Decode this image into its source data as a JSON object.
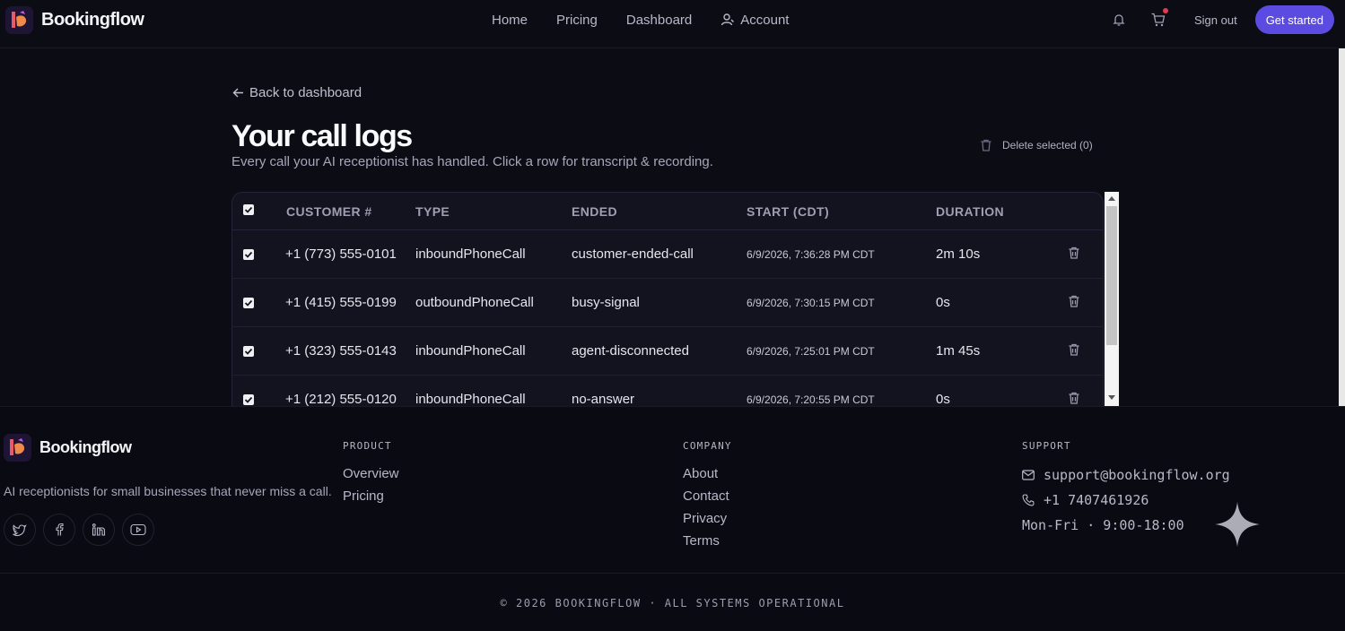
{
  "brand": {
    "name": "Bookingflow"
  },
  "nav": {
    "links": [
      "Home",
      "Pricing",
      "Dashboard",
      "Account"
    ],
    "sign_out": "Sign out",
    "get_started": "Get started",
    "cart_has_items": true
  },
  "page": {
    "back_label": "Back to dashboard",
    "title": "Your call logs",
    "subtitle": "Every call your AI receptionist has handled. Click a row for transcript & recording.",
    "delete_selected": "Delete selected (0)"
  },
  "table": {
    "columns": [
      "CUSTOMER #",
      "TYPE",
      "ENDED",
      "START (CDT)",
      "DURATION"
    ],
    "rows": [
      {
        "customer": "+1 (773) 555-0101",
        "type": "inboundPhoneCall",
        "ended": "customer-ended-call",
        "start": "6/9/2026, 7:36:28 PM CDT",
        "duration": "2m 10s"
      },
      {
        "customer": "+1 (415) 555-0199",
        "type": "outboundPhoneCall",
        "ended": "busy-signal",
        "start": "6/9/2026, 7:30:15 PM CDT",
        "duration": "0s"
      },
      {
        "customer": "+1 (323) 555-0143",
        "type": "inboundPhoneCall",
        "ended": "agent-disconnected",
        "start": "6/9/2026, 7:25:01 PM CDT",
        "duration": "1m 45s"
      },
      {
        "customer": "+1 (212) 555-0120",
        "type": "inboundPhoneCall",
        "ended": "no-answer",
        "start": "6/9/2026, 7:20:55 PM CDT",
        "duration": "0s"
      }
    ]
  },
  "footer": {
    "tagline": "AI receptionists for small businesses that never miss a call.",
    "socials": [
      "twitter-icon",
      "facebook-icon",
      "linkedin-icon",
      "youtube-icon"
    ],
    "product": {
      "title": "PRODUCT",
      "links": [
        "Overview",
        "Pricing"
      ]
    },
    "company": {
      "title": "COMPANY",
      "links": [
        "About",
        "Contact",
        "Privacy",
        "Terms"
      ]
    },
    "support": {
      "title": "SUPPORT",
      "email": "support@bookingflow.org",
      "phone": "+1 7407461926",
      "hours": "Mon-Fri · 9:00-18:00"
    },
    "copyright": "© 2026 BOOKINGFLOW · ALL SYSTEMS OPERATIONAL"
  },
  "colors": {
    "background": "#0c0c15",
    "accent": "#5b4be0",
    "cart_badge": "#e23b4e"
  }
}
